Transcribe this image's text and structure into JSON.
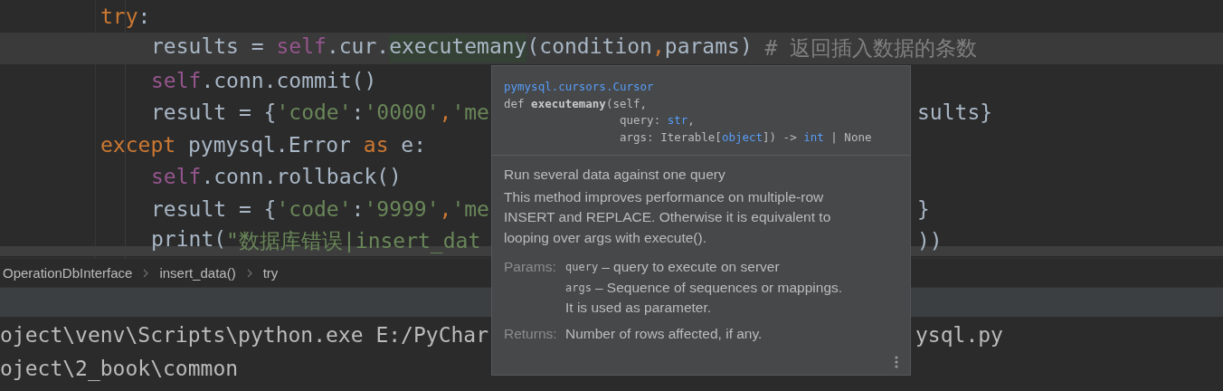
{
  "editor": {
    "lines": [
      {
        "current": false,
        "tokens": [
          {
            "text": "try",
            "kind": "keyword"
          },
          {
            "text": ":",
            "kind": "plain"
          }
        ],
        "children": [
          {
            "current": true,
            "tokens": [
              {
                "text": "results = ",
                "kind": "plain"
              },
              {
                "text": "self",
                "kind": "self"
              },
              {
                "text": ".cur.",
                "kind": "plain"
              },
              {
                "text": "executemany",
                "kind": "match"
              },
              {
                "text": "(condition",
                "kind": "plain"
              },
              {
                "text": ",",
                "kind": "keyword"
              },
              {
                "text": "params) ",
                "kind": "plain"
              },
              {
                "text": "# 返回插入数据的条数",
                "kind": "comment"
              }
            ]
          },
          {
            "current": false,
            "tokens": [
              {
                "text": "self",
                "kind": "self"
              },
              {
                "text": ".conn.commit()",
                "kind": "plain"
              }
            ]
          },
          {
            "current": false,
            "tokens": [
              {
                "text": "result = {",
                "kind": "plain"
              },
              {
                "text": "'code'",
                "kind": "string"
              },
              {
                "text": ":",
                "kind": "plain"
              },
              {
                "text": "'0000'",
                "kind": "string"
              },
              {
                "text": ",",
                "kind": "keyword"
              },
              {
                "text": "'me",
                "kind": "string"
              }
            ],
            "tail": [
              {
                "text": "sults}",
                "kind": "plain"
              }
            ]
          }
        ]
      },
      {
        "current": false,
        "tokens": [
          {
            "text": "except ",
            "kind": "keyword"
          },
          {
            "text": "pymysql.Error ",
            "kind": "plain"
          },
          {
            "text": "as ",
            "kind": "keyword"
          },
          {
            "text": "e:",
            "kind": "plain"
          }
        ],
        "children": [
          {
            "current": false,
            "tokens": [
              {
                "text": "self",
                "kind": "self"
              },
              {
                "text": ".conn.rollback()",
                "kind": "plain"
              }
            ]
          },
          {
            "current": false,
            "tokens": [
              {
                "text": "result = {",
                "kind": "plain"
              },
              {
                "text": "'code'",
                "kind": "string"
              },
              {
                "text": ":",
                "kind": "plain"
              },
              {
                "text": "'9999'",
                "kind": "string"
              },
              {
                "text": ",",
                "kind": "keyword"
              },
              {
                "text": "'me",
                "kind": "string"
              }
            ],
            "tail": [
              {
                "text": "}",
                "kind": "plain"
              }
            ]
          },
          {
            "current": false,
            "tokens": [
              {
                "text": "print(",
                "kind": "plain"
              },
              {
                "text": "\"数据库错误|insert_dat",
                "kind": "string"
              }
            ],
            "tail": [
              {
                "text": "))",
                "kind": "plain"
              }
            ]
          }
        ]
      }
    ]
  },
  "breadcrumbs": [
    "OperationDbInterface",
    "insert_data()",
    "try"
  ],
  "console": [
    {
      "text": "oject\\venv\\Scripts\\python.exe E:/PyChar",
      "tail": "ysql.py"
    },
    {
      "text": "oject\\2_book\\common"
    }
  ],
  "popup": {
    "signature": [
      {
        "kind": "first",
        "tokens": [
          {
            "text": "pymysql.cursors.Cursor",
            "kind": "type"
          }
        ]
      },
      {
        "kind": "first",
        "tokens": [
          {
            "text": "def ",
            "kind": "plain"
          },
          {
            "text": "executemany",
            "kind": "name"
          },
          {
            "text": "(self,",
            "kind": "plain"
          }
        ]
      },
      {
        "kind": "continuation",
        "tokens": [
          {
            "text": "query: ",
            "kind": "plain"
          },
          {
            "text": "str",
            "kind": "type"
          },
          {
            "text": ",",
            "kind": "plain"
          }
        ]
      },
      {
        "kind": "continuation",
        "tokens": [
          {
            "text": "args: Iterable[",
            "kind": "plain"
          },
          {
            "text": "object",
            "kind": "type"
          },
          {
            "text": "]) -> ",
            "kind": "plain"
          },
          {
            "text": "int",
            "kind": "type"
          },
          {
            "text": " | None",
            "kind": "plain"
          }
        ]
      }
    ],
    "summary": "Run several data against one query",
    "description": "This method improves performance on multiple-row INSERT and REPLACE. Otherwise it is equivalent to looping over args with execute().",
    "params_label": "Params:",
    "params": [
      {
        "name": "query",
        "lines": [
          "– query to execute on server"
        ]
      },
      {
        "name": "args",
        "lines": [
          "– Sequence of sequences or mappings.",
          "It is used as parameter."
        ]
      }
    ],
    "returns_label": "Returns:",
    "returns": "Number of rows affected, if any."
  }
}
